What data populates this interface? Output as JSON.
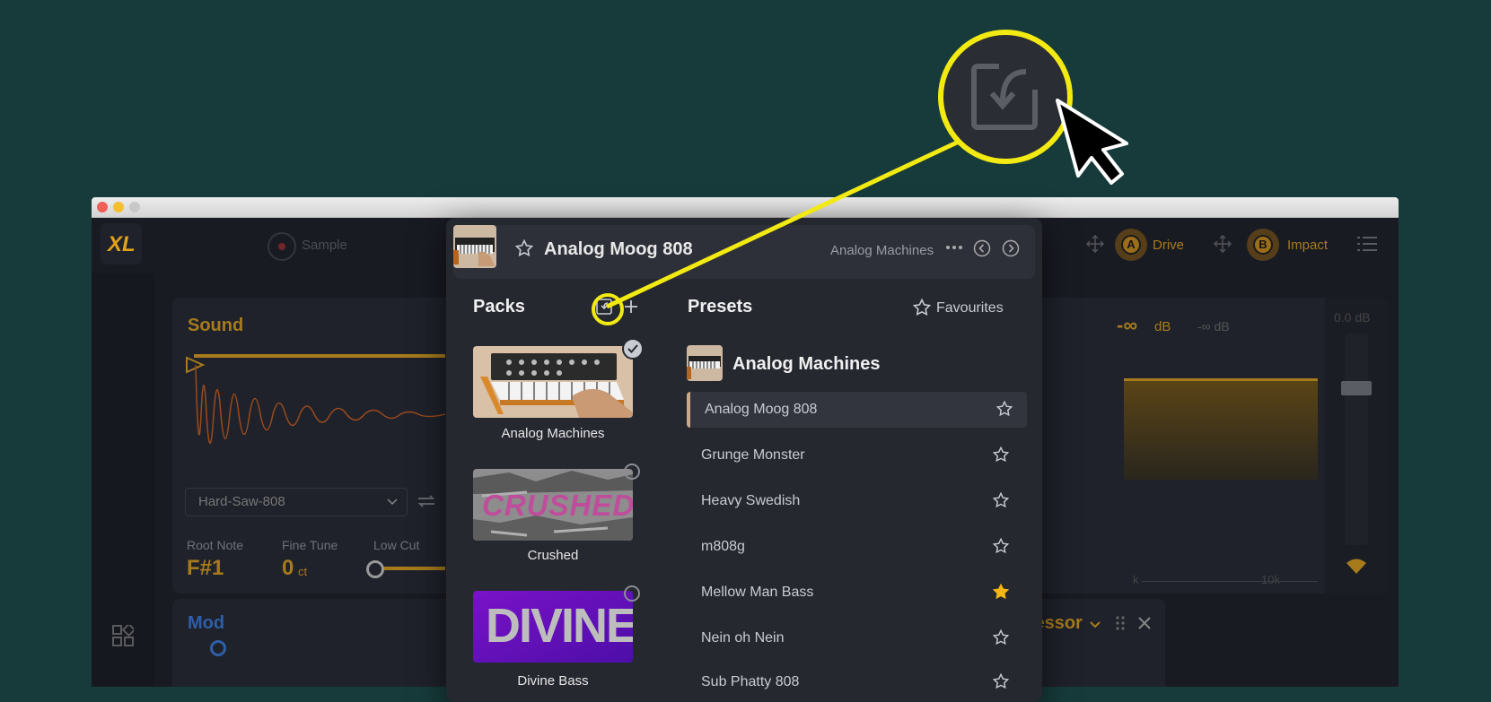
{
  "app": {
    "logo": "XL",
    "sample_label": "Sample",
    "drive_label": "Drive",
    "impact_label": "Impact",
    "drive_badge": "A",
    "impact_badge": "B"
  },
  "sound_panel": {
    "title": "Sound",
    "sample_select": "Hard-Saw-808",
    "root_note_label": "Root Note",
    "root_note_value": "F#1",
    "fine_tune_label": "Fine Tune",
    "fine_tune_value": "0",
    "fine_tune_unit": "ct",
    "low_cut_label": "Low Cut"
  },
  "meter_panel": {
    "level_value": "-∞",
    "level_unit": "dB",
    "level_value2": "-∞ dB",
    "gain_readout": "0.0 dB",
    "freq_label_k": "k",
    "freq_label_10k": "10k"
  },
  "mod_panel": {
    "title": "Mod"
  },
  "compressor_panel": {
    "title": "Compressor"
  },
  "popup": {
    "current_preset": "Analog Moog 808",
    "current_pack": "Analog Machines",
    "packs_title": "Packs",
    "presets_title": "Presets",
    "favourites_label": "Favourites",
    "pack_group_title": "Analog Machines",
    "packs": [
      {
        "label": "Analog Machines",
        "selected": true
      },
      {
        "label": "Crushed",
        "art_text": "CRUSHED",
        "selected": false
      },
      {
        "label": "Divine Bass",
        "art_text": "DIVINE",
        "selected": false
      }
    ],
    "presets": [
      {
        "label": "Analog Moog 808",
        "favourite": false,
        "active": true
      },
      {
        "label": "Grunge Monster",
        "favourite": false,
        "active": false
      },
      {
        "label": "Heavy Swedish",
        "favourite": false,
        "active": false
      },
      {
        "label": "m808g",
        "favourite": false,
        "active": false
      },
      {
        "label": "Mellow Man Bass",
        "favourite": true,
        "active": false
      },
      {
        "label": "Nein oh Nein",
        "favourite": false,
        "active": false
      },
      {
        "label": "Sub Phatty 808",
        "favourite": false,
        "active": false
      }
    ]
  },
  "colors": {
    "background": "#173b3b",
    "highlight": "#f2ea12",
    "accent_orange": "#e0a21a",
    "favourite_star": "#f5b614"
  },
  "callout": {
    "icon": "import-icon",
    "cursor": "arrow-cursor"
  }
}
